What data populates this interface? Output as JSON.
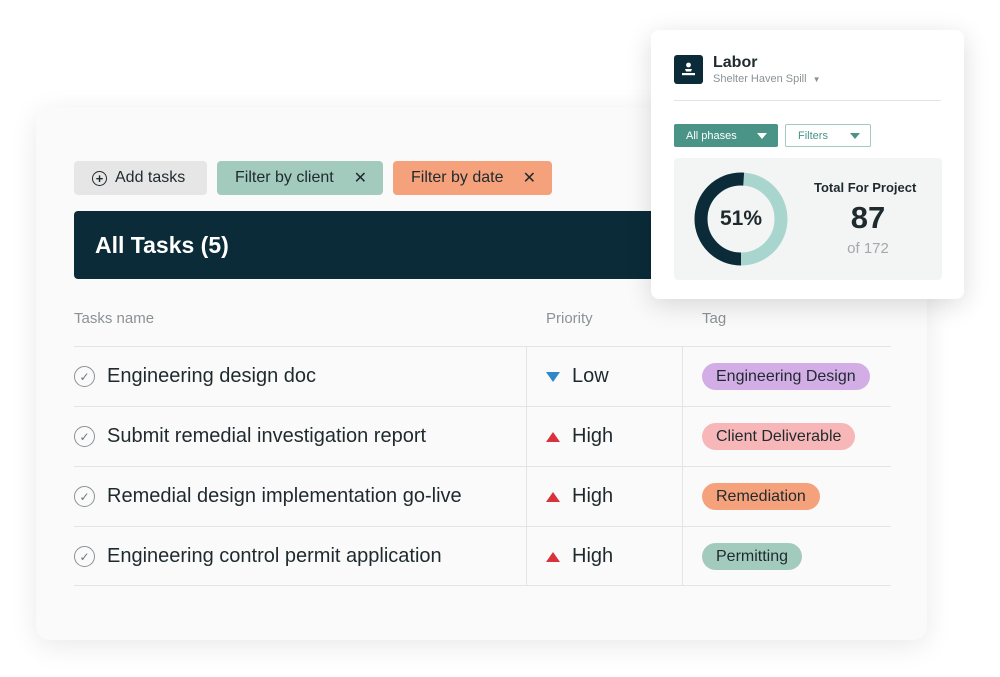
{
  "toolbar": {
    "add_tasks_label": "Add tasks",
    "filter_client_label": "Filter by client",
    "filter_date_label": "Filter by date",
    "remove_symbol": "✕"
  },
  "tasks_header": {
    "title": "All Tasks (5)"
  },
  "columns": {
    "name": "Tasks name",
    "priority": "Priority",
    "tag": "Tag"
  },
  "tasks": [
    {
      "name": "Engineering design doc",
      "priority": "Low",
      "priority_direction": "down",
      "tag": "Engineering Design",
      "tag_color": "#d3aee6"
    },
    {
      "name": "Submit remedial investigation report",
      "priority": "High",
      "priority_direction": "up",
      "tag": "Client Deliverable",
      "tag_color": "#f7b7b8"
    },
    {
      "name": "Remedial design implementation go-live",
      "priority": "High",
      "priority_direction": "up",
      "tag": "Remediation",
      "tag_color": "#f5a27c"
    },
    {
      "name": "Engineering control permit application",
      "priority": "High",
      "priority_direction": "up",
      "tag": "Permitting",
      "tag_color": "#a3cbbd"
    }
  ],
  "labor": {
    "title": "Labor",
    "project": "Shelter Haven Spill",
    "phase_filter": "All phases",
    "filters_label": "Filters",
    "percent_label": "51%",
    "percent_value": 0.51,
    "total_label": "Total For Project",
    "total_value": "87",
    "total_of": "of 172"
  },
  "colors": {
    "header_dark": "#0b2b38",
    "teal": "#4a9387",
    "donut_track": "#a8d5cd",
    "donut_fill": "#0b2b38",
    "priority_low": "#2f86c8",
    "priority_high": "#d8323a"
  },
  "icons": {
    "add": "plus-circle-icon",
    "check": "check-circle-icon",
    "labor": "labor-icon",
    "dropdown": "chevron-down-icon"
  }
}
